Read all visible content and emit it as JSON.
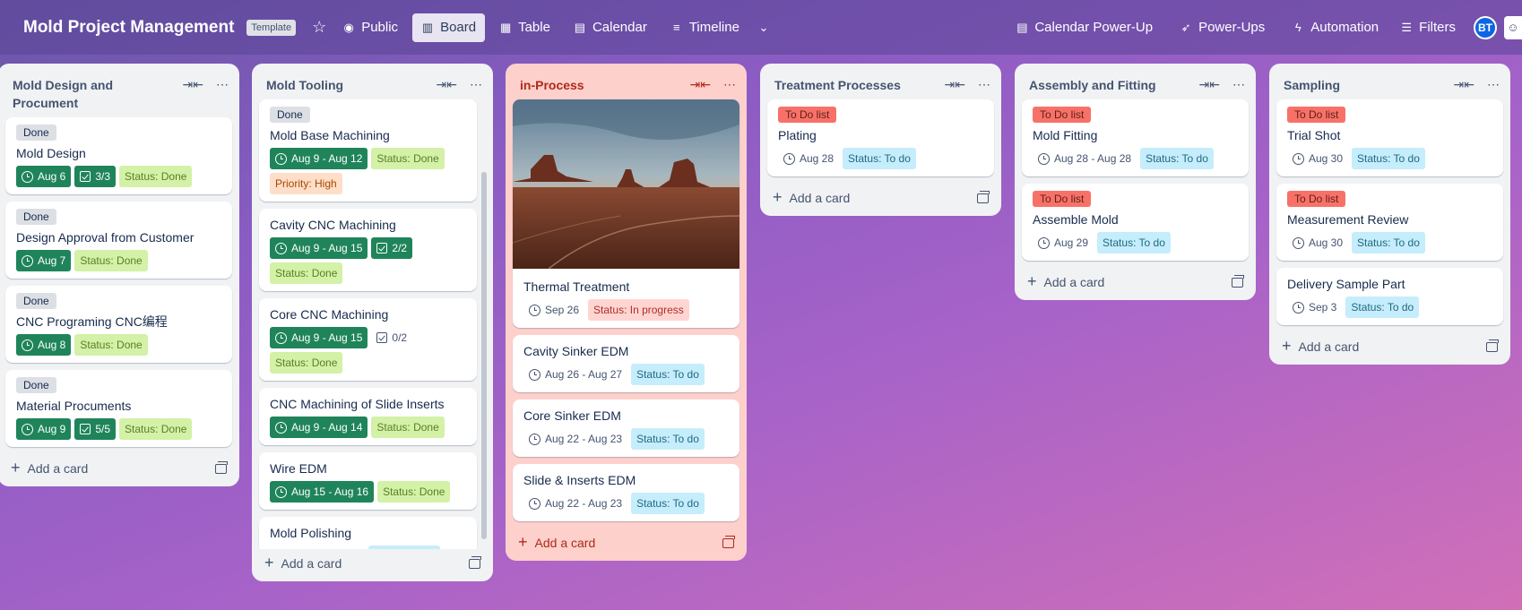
{
  "header": {
    "title": "Mold Project Management",
    "template_badge": "Template",
    "visibility": "Public",
    "views": [
      "Board",
      "Table",
      "Calendar",
      "Timeline"
    ],
    "right": [
      "Calendar Power-Up",
      "Power-Ups",
      "Automation",
      "Filters"
    ],
    "avatar": "BT"
  },
  "lists": [
    {
      "title": "Mold Design and Procument",
      "cards": [
        {
          "label": "Done",
          "title": "Mold Design",
          "date": "Aug 6",
          "check": "3/3",
          "status": "Status: Done"
        },
        {
          "label": "Done",
          "title": "Design Approval from Customer",
          "date": "Aug 7",
          "status": "Status: Done"
        },
        {
          "label": "Done",
          "title": "CNC Programing CNC编程",
          "date": "Aug 8",
          "status": "Status: Done"
        },
        {
          "label": "Done",
          "title": "Material Procuments",
          "date": "Aug 9",
          "check": "5/5",
          "status": "Status: Done"
        }
      ],
      "add": "Add a card"
    },
    {
      "title": "Mold Tooling",
      "cards": [
        {
          "label": "Done",
          "title": "Mold Base Machining",
          "date": "Aug 9 - Aug 12",
          "status": "Status: Done",
          "priority": "Priority: High"
        },
        {
          "title": "Cavity CNC Machining",
          "date": "Aug 9 - Aug 15",
          "check": "2/2",
          "status": "Status: Done"
        },
        {
          "title": "Core CNC Machining",
          "date": "Aug 9 - Aug 15",
          "check": "0/2",
          "status": "Status: Done"
        },
        {
          "title": "CNC Machining of Slide Inserts",
          "date": "Aug 9 - Aug 14",
          "status": "Status: Done"
        },
        {
          "title": "Wire EDM",
          "date": "Aug 15 - Aug 16",
          "status": "Status: Done"
        },
        {
          "title": "Mold Polishing"
        }
      ],
      "add": "Add a card"
    },
    {
      "title": "in-Process",
      "cards": [
        {
          "title": "Thermal Treatment",
          "date": "Sep 26",
          "status": "Status: In progress"
        },
        {
          "title": "Cavity Sinker EDM",
          "date": "Aug 26 - Aug 27",
          "status": "Status: To do"
        },
        {
          "title": "Core Sinker EDM",
          "date": "Aug 22 - Aug 23",
          "status": "Status: To do"
        },
        {
          "title": "Slide & Inserts EDM",
          "date": "Aug 22 - Aug 23",
          "status": "Status: To do"
        }
      ],
      "add": "Add a card"
    },
    {
      "title": "Treatment Processes",
      "cards": [
        {
          "label": "To Do list",
          "title": "Plating",
          "date": "Aug 28",
          "status": "Status: To do"
        }
      ],
      "add": "Add a card"
    },
    {
      "title": "Assembly and Fitting",
      "cards": [
        {
          "label": "To Do list",
          "title": "Mold Fitting",
          "date": "Aug 28 - Aug 28",
          "status": "Status: To do"
        },
        {
          "label": "To Do list",
          "title": "Assemble Mold",
          "date": "Aug 29",
          "status": "Status: To do"
        }
      ],
      "add": "Add a card"
    },
    {
      "title": "Sampling",
      "cards": [
        {
          "label": "To Do list",
          "title": "Trial Shot",
          "date": "Aug 30",
          "status": "Status: To do"
        },
        {
          "label": "To Do list",
          "title": "Measurement Review",
          "date": "Aug 30",
          "status": "Status: To do"
        },
        {
          "title": "Delivery Sample Part",
          "date": "Sep 3",
          "status": "Status: To do"
        }
      ],
      "add": "Add a card"
    }
  ]
}
